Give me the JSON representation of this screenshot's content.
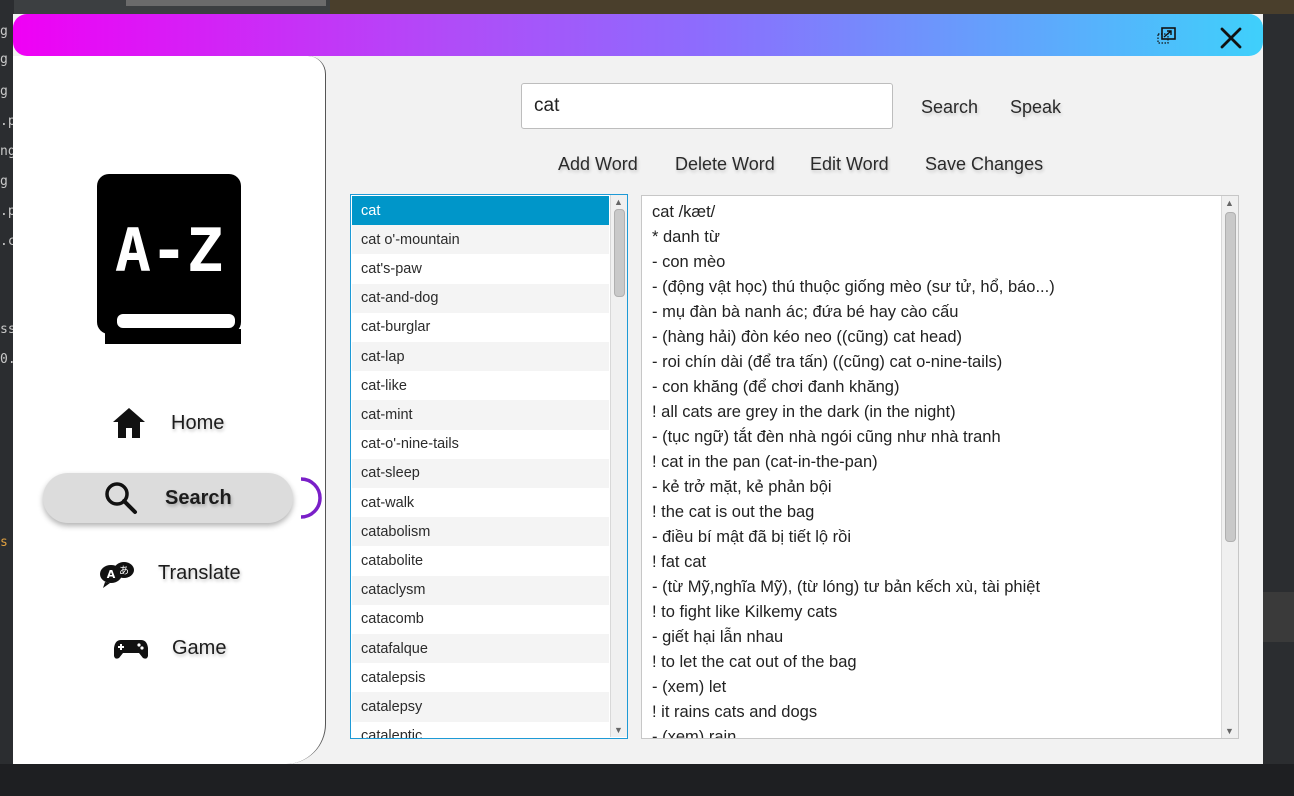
{
  "background": {
    "left_chars": [
      "g",
      "g",
      "g",
      ".p",
      "ng",
      "g",
      ".p",
      ".cs",
      "ss",
      "0.",
      "s"
    ]
  },
  "titlebar": {
    "restore_icon": "restore-window-icon",
    "close_icon": "close-icon"
  },
  "sidebar": {
    "logo_text": "A-Z",
    "nav": [
      {
        "label": "Home",
        "icon": "home-icon"
      },
      {
        "label": "Search",
        "icon": "search-icon"
      },
      {
        "label": "Translate",
        "icon": "translate-icon"
      },
      {
        "label": "Game",
        "icon": "gamepad-icon"
      }
    ],
    "active": "Search"
  },
  "search": {
    "value": "cat",
    "search_label": "Search",
    "speak_label": "Speak"
  },
  "toolbar": {
    "add_label": "Add Word",
    "delete_label": "Delete Word",
    "edit_label": "Edit Word",
    "save_label": "Save Changes"
  },
  "word_list": {
    "selected": "cat",
    "items": [
      "cat",
      "cat o'-mountain",
      "cat's-paw",
      "cat-and-dog",
      "cat-burglar",
      "cat-lap",
      "cat-like",
      "cat-mint",
      "cat-o'-nine-tails",
      "cat-sleep",
      "cat-walk",
      "catabolism",
      "catabolite",
      "cataclysm",
      "catacomb",
      "catafalque",
      "catalepsis",
      "catalepsy",
      "cataleptic"
    ]
  },
  "definition": {
    "lines": [
      "cat /kæt/",
      "*  danh từ",
      "- con mèo",
      "- (động vật học) thú thuộc giống mèo (sư tử, hổ, báo...)",
      "- mụ đàn bà nanh ác; đứa bé hay cào cấu",
      "- (hàng hải) đòn kéo neo ((cũng) cat head)",
      "- roi chín dài (để tra tấn) ((cũng) cat o-nine-tails)",
      "- con khăng (để chơi đanh khăng)",
      "! all cats are grey in the dark (in the night)",
      "- (tục ngữ) tắt đèn nhà ngói cũng như nhà tranh",
      "! cat in the pan (cat-in-the-pan)",
      "- kẻ trở mặt, kẻ phản bội",
      "! the cat is out the bag",
      "- điều bí mật đã bị tiết lộ rồi",
      "! fat cat",
      "- (từ Mỹ,nghĩa Mỹ),  (từ lóng) tư bản kếch xù, tài phiệt",
      "! to fight like Kilkemy cats",
      "- giết hại lẫn nhau",
      "! to let the cat out of the bag",
      "- (xem) let",
      "! it rains cats and dogs",
      "- (xem) rain"
    ]
  },
  "colors": {
    "gradient_start": "#f000f5",
    "gradient_end": "#3fd0fb",
    "selection": "#0096c9",
    "active_arc": "#7a1fc8"
  }
}
